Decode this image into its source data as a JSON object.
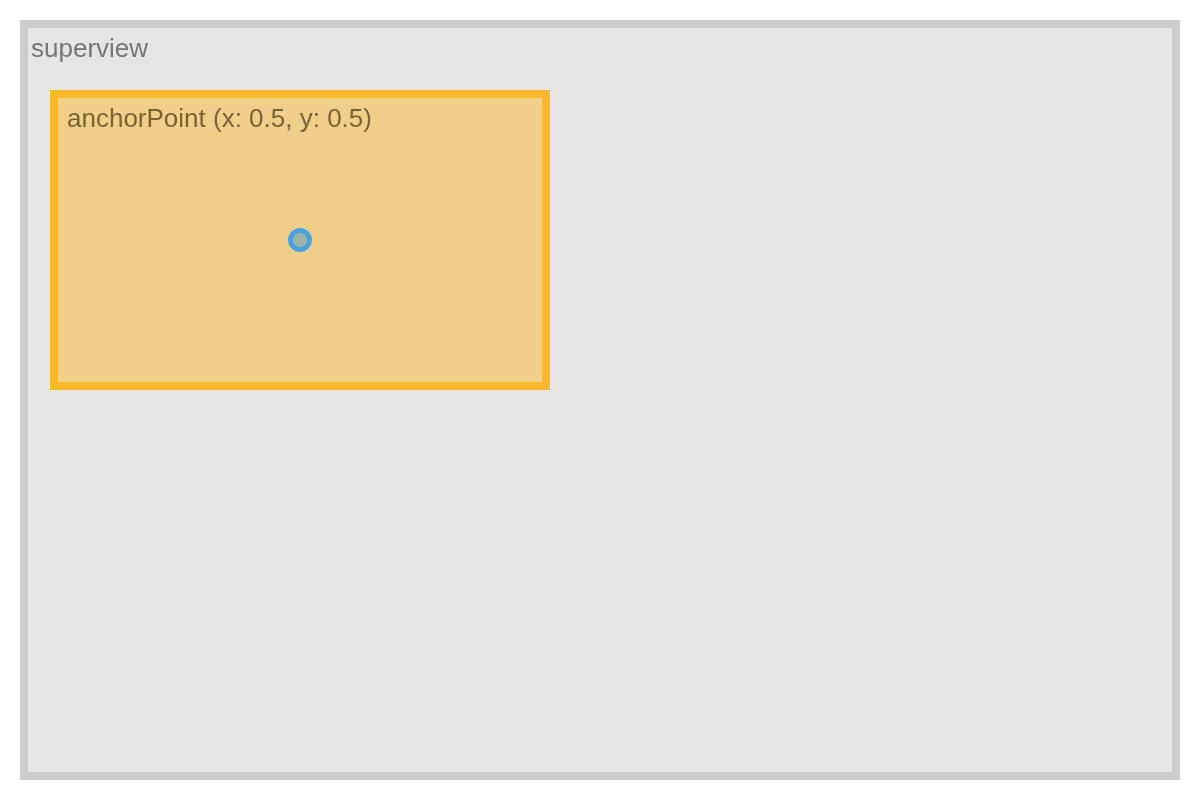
{
  "superview": {
    "title": "superview"
  },
  "view": {
    "title": "anchorPoint (x: 0.5, y: 0.5)"
  }
}
